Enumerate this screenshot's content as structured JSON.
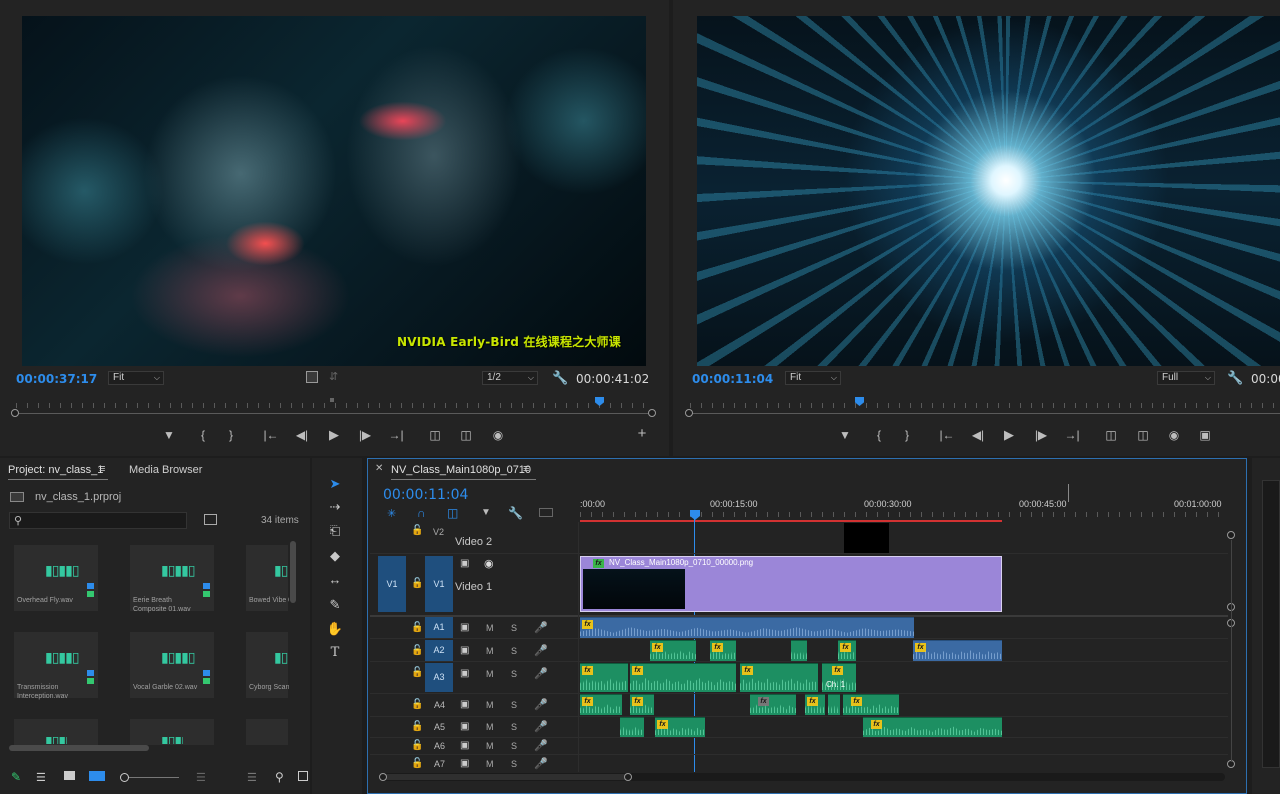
{
  "source_monitor": {
    "subtitle": "NVIDIA Early-Bird 在线课程之大师课",
    "timecode_current": "00:00:37:17",
    "zoom": "Fit",
    "resolution": "1/2",
    "timecode_duration": "00:00:41:02"
  },
  "program_monitor": {
    "timecode_current": "00:00:11:04",
    "zoom": "Fit",
    "resolution": "Full",
    "timecode_right": "00:00"
  },
  "project": {
    "tab_project": "Project: nv_class_1",
    "tab_media": "Media Browser",
    "file_name": "nv_class_1.prproj",
    "item_count": "34 items",
    "items": [
      {
        "name": "Overhead Fly.wav"
      },
      {
        "name": "Eerie Breath Composite 01.wav"
      },
      {
        "name": "Bowed Vibe 01"
      },
      {
        "name": "Transmission Interception.wav"
      },
      {
        "name": "Vocal Garble 02.wav"
      },
      {
        "name": "Cyborg Scan Ri"
      }
    ]
  },
  "timeline": {
    "sequence_name": "NV_Class_Main1080p_0710",
    "timecode": "00:00:11:04",
    "ruler_labels": [
      ":00:00",
      "00:00:15:00",
      "00:00:30:00",
      "00:00:45:00",
      "00:01:00:00"
    ],
    "tracks_video": [
      {
        "id": "V2",
        "name": "Video 2"
      },
      {
        "id": "V1",
        "name": "Video 1",
        "source": "V1"
      }
    ],
    "tracks_audio": [
      "A1",
      "A2",
      "A3",
      "A4",
      "A5",
      "A6",
      "A7"
    ],
    "video_clip_name": "NV_Class_Main1080p_0710_00000.png",
    "clip_label_ch1": "Ch. 1",
    "toggle_m": "M",
    "toggle_s": "S"
  },
  "colors": {
    "accent_blue": "#2d8ceb",
    "audio_clip": "#1d8f62",
    "video_clip": "#9b86d8",
    "work_area_red": "#d23232"
  }
}
